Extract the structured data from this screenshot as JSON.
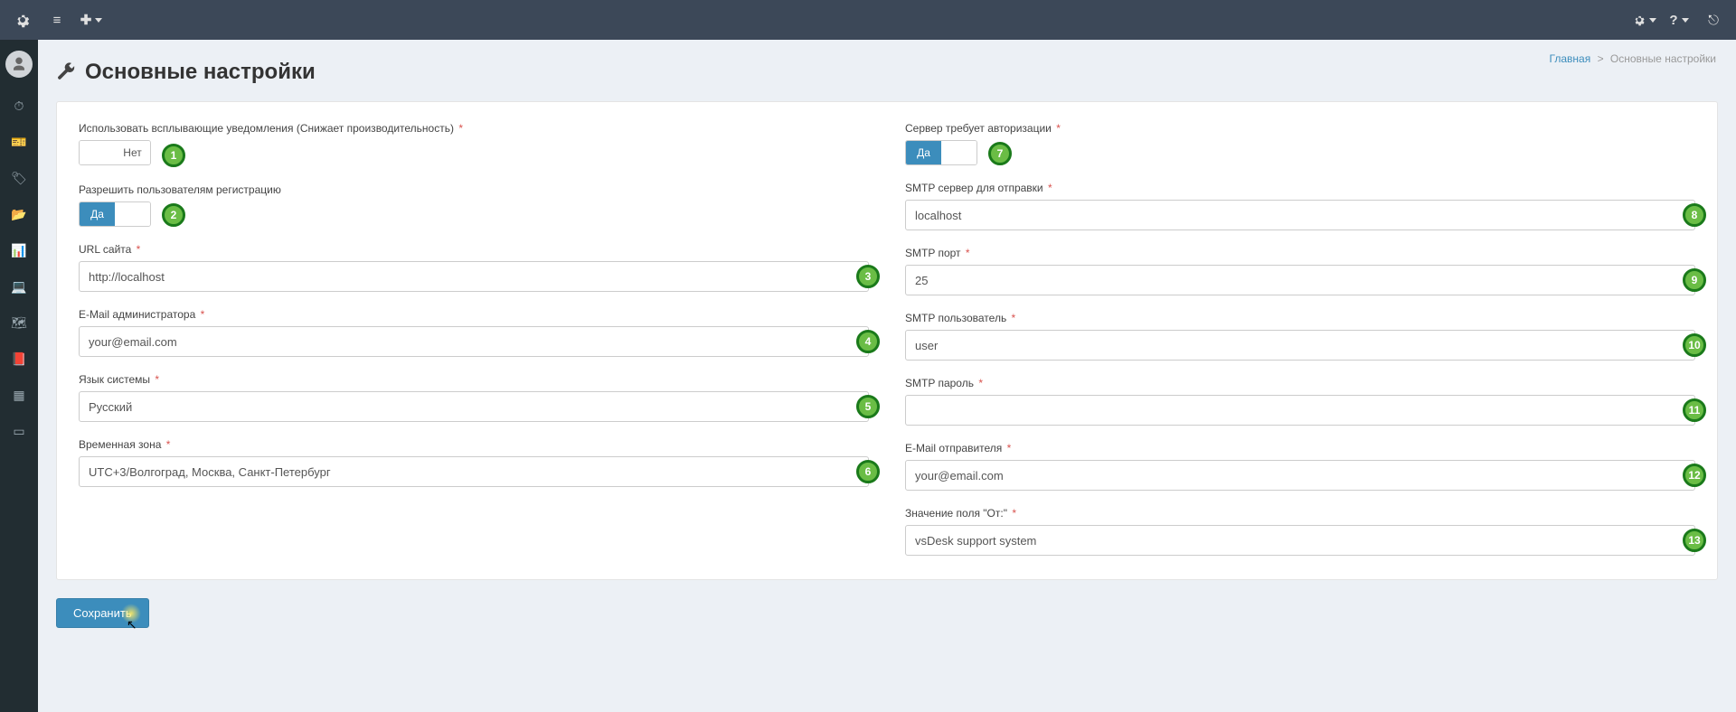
{
  "topbar": {
    "settings_icon": "gear",
    "toggle_menu_icon": "bars",
    "add_menu_icon": "plus",
    "help_icon": "question",
    "logout_icon": "signout"
  },
  "breadcrumb": {
    "home": "Главная",
    "current": "Основные настройки"
  },
  "page": {
    "title": "Основные настройки"
  },
  "left": {
    "popup_notify": {
      "label": "Использовать всплывающие уведомления (Снижает производительность)",
      "value_off": "Нет",
      "state": "off",
      "marker": "1"
    },
    "allow_register": {
      "label": "Разрешить пользователям регистрацию",
      "value_on": "Да",
      "state": "on",
      "marker": "2"
    },
    "site_url": {
      "label": "URL сайта",
      "value": "http://localhost",
      "marker": "3"
    },
    "admin_email": {
      "label": "E-Mail администратора",
      "value": "your@email.com",
      "marker": "4"
    },
    "sys_lang": {
      "label": "Язык системы",
      "value": "Русский",
      "marker": "5"
    },
    "timezone": {
      "label": "Временная зона",
      "value": "UTC+3/Волгоград, Москва, Санкт-Петербург",
      "marker": "6"
    }
  },
  "right": {
    "smtp_auth": {
      "label": "Сервер требует авторизации",
      "value_on": "Да",
      "state": "on",
      "marker": "7"
    },
    "smtp_host": {
      "label": "SMTP сервер для отправки",
      "value": "localhost",
      "marker": "8"
    },
    "smtp_port": {
      "label": "SMTP порт",
      "value": "25",
      "marker": "9"
    },
    "smtp_user": {
      "label": "SMTP пользователь",
      "value": "user",
      "marker": "10"
    },
    "smtp_pass": {
      "label": "SMTP пароль",
      "value": "",
      "marker": "11"
    },
    "sender_email": {
      "label": "E-Mail отправителя",
      "value": "your@email.com",
      "marker": "12"
    },
    "from_field": {
      "label": "Значение поля \"От:\"",
      "value": "vsDesk support system",
      "marker": "13"
    }
  },
  "actions": {
    "save": "Сохранить"
  }
}
